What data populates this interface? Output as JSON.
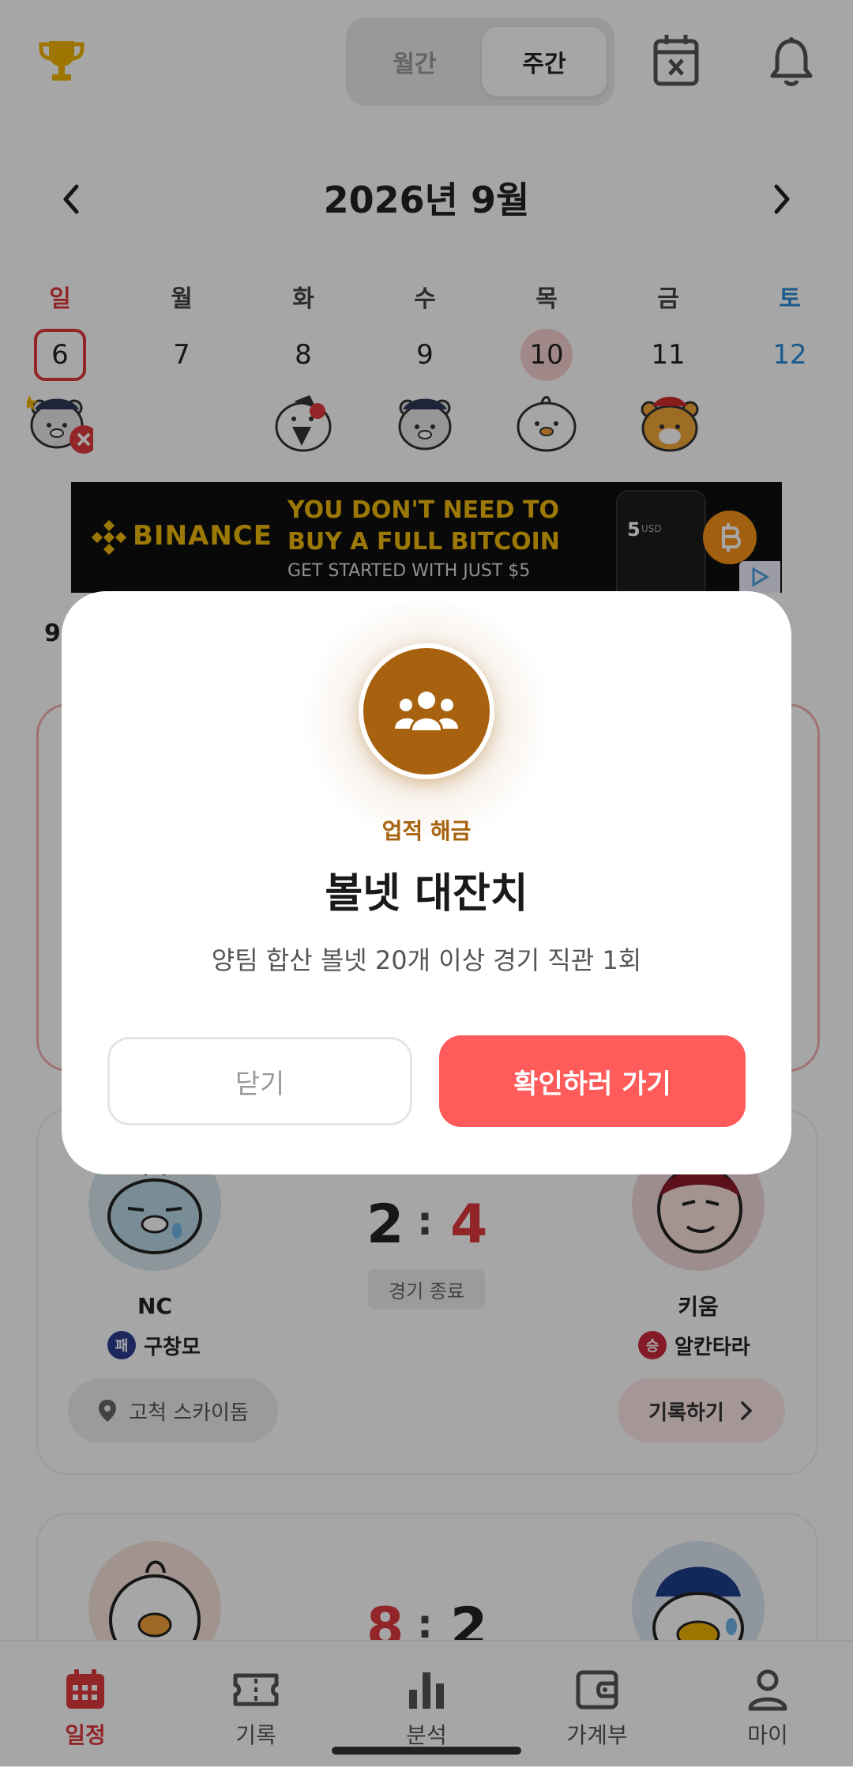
{
  "header": {
    "segment": {
      "monthly": "월간",
      "weekly": "주간",
      "selected": "weekly"
    },
    "icons": [
      "trophy-icon",
      "calendar-x-icon",
      "bell-icon"
    ]
  },
  "calendar": {
    "title": "2026년 9월",
    "weekdays": [
      "일",
      "월",
      "화",
      "수",
      "목",
      "금",
      "토"
    ],
    "dates": [
      "6",
      "7",
      "8",
      "9",
      "10",
      "11",
      "12"
    ],
    "selected_date": "6",
    "today_date": "10"
  },
  "ad": {
    "brand": "BINANCE",
    "headline_1": "YOU DON'T NEED TO",
    "headline_2": "BUY A FULL BITCOIN",
    "subline": "GET STARTED WITH JUST $5",
    "phone_amount": "5",
    "phone_unit": "USD"
  },
  "games": [
    {
      "away_team": "NC",
      "home_team": "키움",
      "away_score": "2",
      "home_score": "4",
      "separator": ":",
      "status": "경기 종료",
      "away_pitcher_badge": "패",
      "away_pitcher": "구창모",
      "home_pitcher_badge": "승",
      "home_pitcher": "알칸타라",
      "location": "고척 스카이돔",
      "record_button": "기록하기"
    },
    {
      "away_score": "8",
      "home_score": "2",
      "separator": ":"
    }
  ],
  "bottom_nav": [
    {
      "label": "일정",
      "icon": "calendar-icon",
      "active": true
    },
    {
      "label": "기록",
      "icon": "ticket-icon",
      "active": false
    },
    {
      "label": "분석",
      "icon": "bar-chart-icon",
      "active": false
    },
    {
      "label": "가계부",
      "icon": "wallet-icon",
      "active": false
    },
    {
      "label": "마이",
      "icon": "user-icon",
      "active": false
    }
  ],
  "modal": {
    "icon": "group-icon",
    "label": "업적 해금",
    "title": "볼넷 대잔치",
    "description": "양팀 합산 볼넷 20개 이상 경기 직관 1회",
    "close_button": "닫기",
    "confirm_button": "확인하러 가기"
  },
  "colors": {
    "accent": "#ff5b5b",
    "achievement": "#a8620f",
    "sunday": "#e0393e",
    "saturday": "#2a8ad6"
  }
}
